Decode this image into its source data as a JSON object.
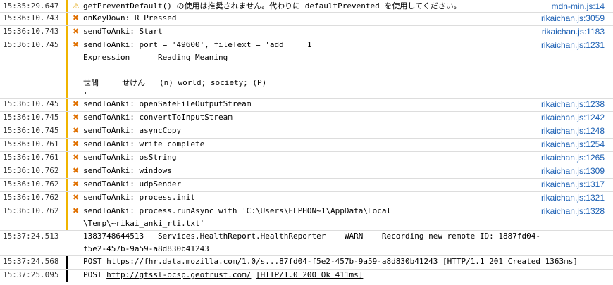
{
  "rows": [
    {
      "time": "15:35:29.647",
      "icon": "warn",
      "message": "getPreventDefault() の使用は推奨されません。代わりに defaultPrevented を使用してください。",
      "source": "mdn-min.js:14"
    },
    {
      "time": "15:36:10.743",
      "icon": "x",
      "message": "onKeyDown: R Pressed",
      "source": "rikaichan.js:3059"
    },
    {
      "time": "15:36:10.743",
      "icon": "x",
      "message": "sendToAnki: Start",
      "source": "rikaichan.js:1183"
    },
    {
      "time": "15:36:10.745",
      "icon": "x",
      "message": "sendToAnki: port = '49600', fileText = 'add     1",
      "extra": [
        "Expression      Reading Meaning",
        "",
        "世間     せけん   (n) world; society; (P)",
        "'"
      ],
      "source": "rikaichan.js:1231"
    },
    {
      "time": "15:36:10.745",
      "icon": "x",
      "message": "sendToAnki: openSafeFileOutputStream",
      "source": "rikaichan.js:1238"
    },
    {
      "time": "15:36:10.745",
      "icon": "x",
      "message": "sendToAnki: convertToInputStream",
      "source": "rikaichan.js:1242"
    },
    {
      "time": "15:36:10.745",
      "icon": "x",
      "message": "sendToAnki: asyncCopy",
      "source": "rikaichan.js:1248"
    },
    {
      "time": "15:36:10.761",
      "icon": "x",
      "message": "sendToAnki: write complete",
      "source": "rikaichan.js:1254"
    },
    {
      "time": "15:36:10.761",
      "icon": "x",
      "message": "sendToAnki: osString",
      "source": "rikaichan.js:1265"
    },
    {
      "time": "15:36:10.762",
      "icon": "x",
      "message": "sendToAnki: windows",
      "source": "rikaichan.js:1309"
    },
    {
      "time": "15:36:10.762",
      "icon": "x",
      "message": "sendToAnki: udpSender",
      "source": "rikaichan.js:1317"
    },
    {
      "time": "15:36:10.762",
      "icon": "x",
      "message": "sendToAnki: process.init",
      "source": "rikaichan.js:1321"
    },
    {
      "time": "15:36:10.762",
      "icon": "x",
      "message": "sendToAnki: process.runAsync with 'C:\\Users\\ELPHON~1\\AppData\\Local",
      "extra": [
        "\\Temp\\~rikai_anki_rti.txt'"
      ],
      "source": "rikaichan.js:1328"
    },
    {
      "time": "15:37:24.513",
      "icon": "",
      "message": "1383748644513   Services.HealthReport.HealthReporter    WARN    Recording new remote ID: 1887fd04-",
      "extra": [
        "f5e2-457b-9a59-a8d830b41243"
      ],
      "source": ""
    }
  ],
  "net_rows": [
    {
      "time": "15:37:24.568",
      "method": "POST",
      "url": "https://fhr.data.mozilla.com/1.0/s...87fd04-f5e2-457b-9a59-a8d830b41243",
      "status": "[HTTP/1.1 201 Created 1363ms]"
    },
    {
      "time": "15:37:25.095",
      "method": "POST",
      "url": "http://gtssl-ocsp.geotrust.com/",
      "status": "[HTTP/1.0 200 Ok 411ms]"
    }
  ],
  "colors": {
    "warning_bar": "#f0b400",
    "network_bar": "#000000",
    "link": "#1a5fb4"
  }
}
